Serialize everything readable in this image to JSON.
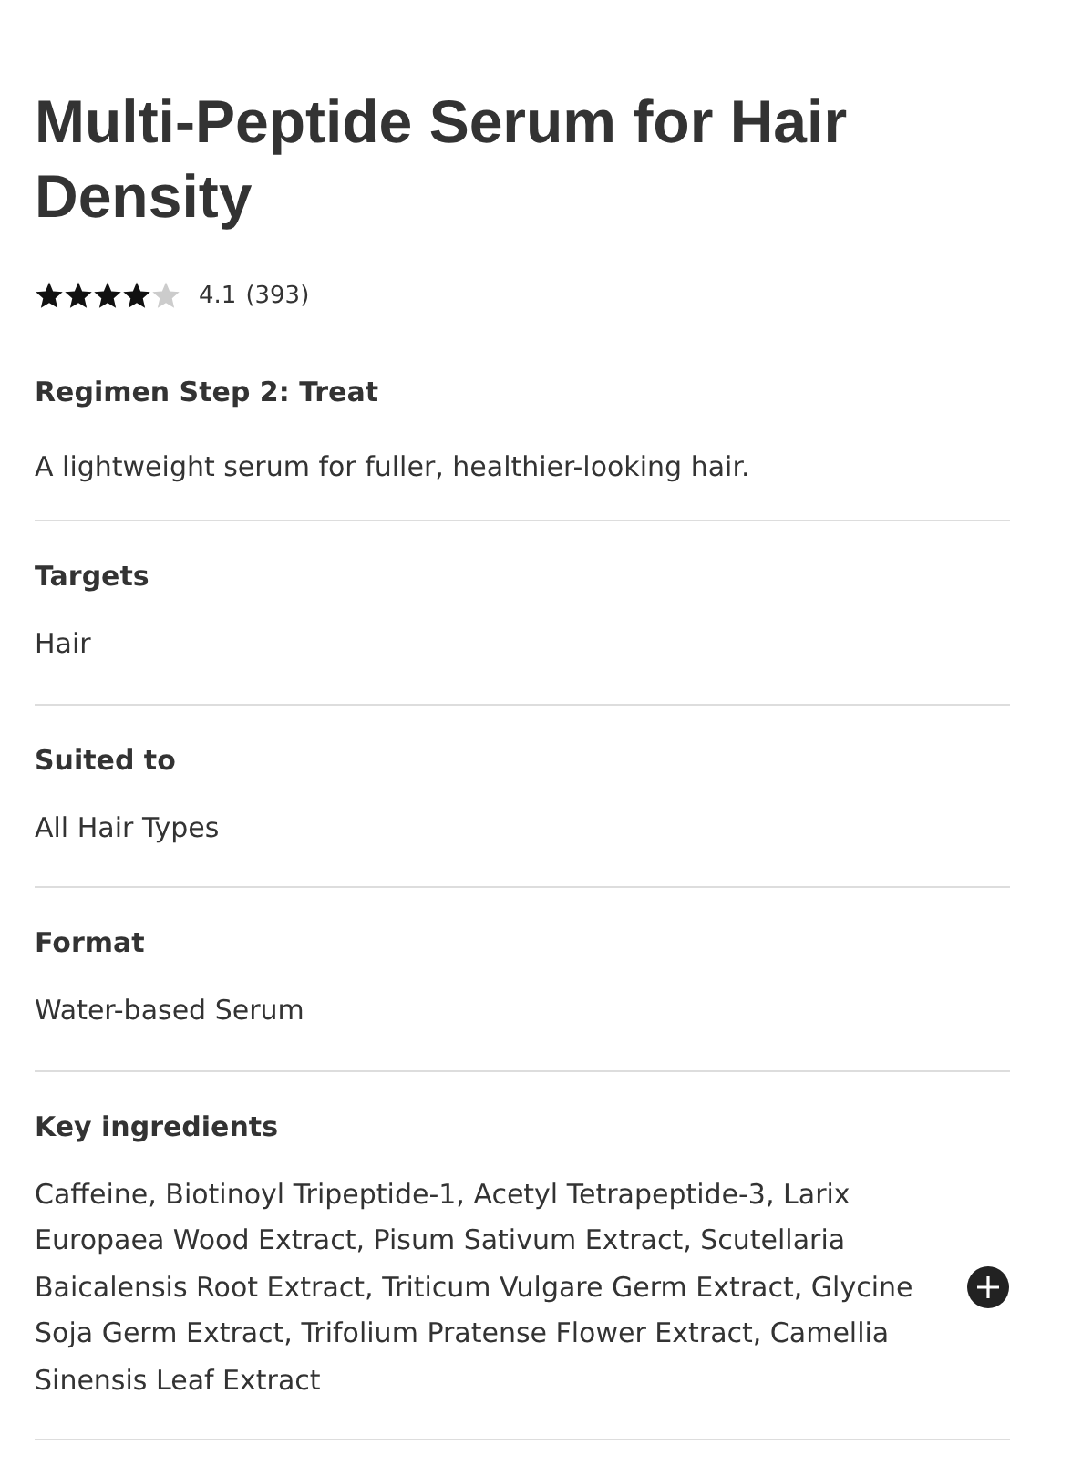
{
  "product": {
    "title": "Multi-Peptide Serum for Hair Density",
    "rating": {
      "stars": 4,
      "score": "4.1",
      "count": "(393)"
    },
    "regimen": "Regimen Step 2: Treat",
    "description": "A lightweight serum for fuller, healthier-looking hair."
  },
  "details": [
    {
      "label": "Targets",
      "value": "Hair"
    },
    {
      "label": "Suited to",
      "value": "All Hair Types"
    },
    {
      "label": "Format",
      "value": "Water-based Serum"
    },
    {
      "label": "Key ingredients",
      "value": "Caffeine, Biotinoyl Tripeptide-1, Acetyl Tetrapeptide-3, Larix Europaea Wood Extract, Pisum Sativum Extract, Scutellaria Baicalensis Root Extract, Triticum Vulgare Germ Extract, Glycine Soja Germ Extract, Trifolium Pratense Flower Extract, Camellia Sinensis Leaf Extract",
      "kind": "expandable"
    }
  ]
}
